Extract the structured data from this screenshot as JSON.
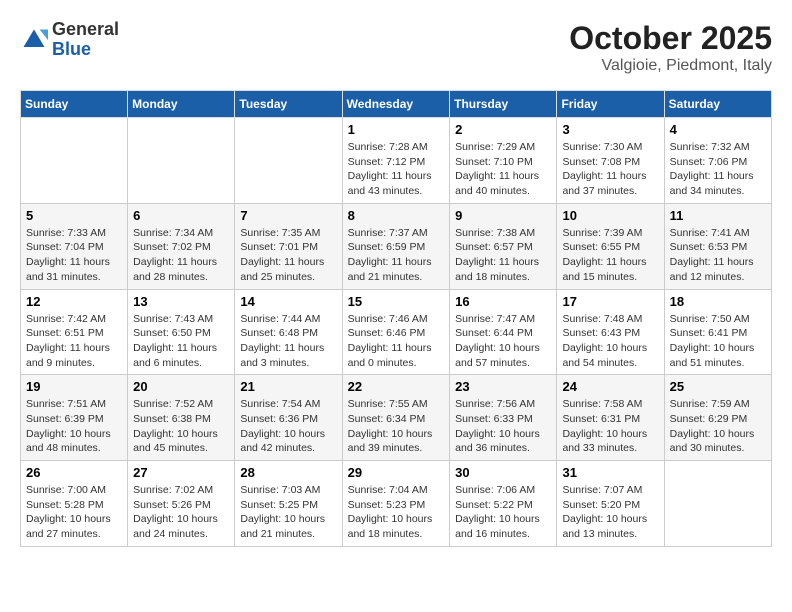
{
  "header": {
    "logo": {
      "general": "General",
      "blue": "Blue"
    },
    "title": "October 2025",
    "location": "Valgioie, Piedmont, Italy"
  },
  "days_of_week": [
    "Sunday",
    "Monday",
    "Tuesday",
    "Wednesday",
    "Thursday",
    "Friday",
    "Saturday"
  ],
  "weeks": [
    [
      {
        "day": "",
        "info": ""
      },
      {
        "day": "",
        "info": ""
      },
      {
        "day": "",
        "info": ""
      },
      {
        "day": "1",
        "info": "Sunrise: 7:28 AM\nSunset: 7:12 PM\nDaylight: 11 hours\nand 43 minutes."
      },
      {
        "day": "2",
        "info": "Sunrise: 7:29 AM\nSunset: 7:10 PM\nDaylight: 11 hours\nand 40 minutes."
      },
      {
        "day": "3",
        "info": "Sunrise: 7:30 AM\nSunset: 7:08 PM\nDaylight: 11 hours\nand 37 minutes."
      },
      {
        "day": "4",
        "info": "Sunrise: 7:32 AM\nSunset: 7:06 PM\nDaylight: 11 hours\nand 34 minutes."
      }
    ],
    [
      {
        "day": "5",
        "info": "Sunrise: 7:33 AM\nSunset: 7:04 PM\nDaylight: 11 hours\nand 31 minutes."
      },
      {
        "day": "6",
        "info": "Sunrise: 7:34 AM\nSunset: 7:02 PM\nDaylight: 11 hours\nand 28 minutes."
      },
      {
        "day": "7",
        "info": "Sunrise: 7:35 AM\nSunset: 7:01 PM\nDaylight: 11 hours\nand 25 minutes."
      },
      {
        "day": "8",
        "info": "Sunrise: 7:37 AM\nSunset: 6:59 PM\nDaylight: 11 hours\nand 21 minutes."
      },
      {
        "day": "9",
        "info": "Sunrise: 7:38 AM\nSunset: 6:57 PM\nDaylight: 11 hours\nand 18 minutes."
      },
      {
        "day": "10",
        "info": "Sunrise: 7:39 AM\nSunset: 6:55 PM\nDaylight: 11 hours\nand 15 minutes."
      },
      {
        "day": "11",
        "info": "Sunrise: 7:41 AM\nSunset: 6:53 PM\nDaylight: 11 hours\nand 12 minutes."
      }
    ],
    [
      {
        "day": "12",
        "info": "Sunrise: 7:42 AM\nSunset: 6:51 PM\nDaylight: 11 hours\nand 9 minutes."
      },
      {
        "day": "13",
        "info": "Sunrise: 7:43 AM\nSunset: 6:50 PM\nDaylight: 11 hours\nand 6 minutes."
      },
      {
        "day": "14",
        "info": "Sunrise: 7:44 AM\nSunset: 6:48 PM\nDaylight: 11 hours\nand 3 minutes."
      },
      {
        "day": "15",
        "info": "Sunrise: 7:46 AM\nSunset: 6:46 PM\nDaylight: 11 hours\nand 0 minutes."
      },
      {
        "day": "16",
        "info": "Sunrise: 7:47 AM\nSunset: 6:44 PM\nDaylight: 10 hours\nand 57 minutes."
      },
      {
        "day": "17",
        "info": "Sunrise: 7:48 AM\nSunset: 6:43 PM\nDaylight: 10 hours\nand 54 minutes."
      },
      {
        "day": "18",
        "info": "Sunrise: 7:50 AM\nSunset: 6:41 PM\nDaylight: 10 hours\nand 51 minutes."
      }
    ],
    [
      {
        "day": "19",
        "info": "Sunrise: 7:51 AM\nSunset: 6:39 PM\nDaylight: 10 hours\nand 48 minutes."
      },
      {
        "day": "20",
        "info": "Sunrise: 7:52 AM\nSunset: 6:38 PM\nDaylight: 10 hours\nand 45 minutes."
      },
      {
        "day": "21",
        "info": "Sunrise: 7:54 AM\nSunset: 6:36 PM\nDaylight: 10 hours\nand 42 minutes."
      },
      {
        "day": "22",
        "info": "Sunrise: 7:55 AM\nSunset: 6:34 PM\nDaylight: 10 hours\nand 39 minutes."
      },
      {
        "day": "23",
        "info": "Sunrise: 7:56 AM\nSunset: 6:33 PM\nDaylight: 10 hours\nand 36 minutes."
      },
      {
        "day": "24",
        "info": "Sunrise: 7:58 AM\nSunset: 6:31 PM\nDaylight: 10 hours\nand 33 minutes."
      },
      {
        "day": "25",
        "info": "Sunrise: 7:59 AM\nSunset: 6:29 PM\nDaylight: 10 hours\nand 30 minutes."
      }
    ],
    [
      {
        "day": "26",
        "info": "Sunrise: 7:00 AM\nSunset: 5:28 PM\nDaylight: 10 hours\nand 27 minutes."
      },
      {
        "day": "27",
        "info": "Sunrise: 7:02 AM\nSunset: 5:26 PM\nDaylight: 10 hours\nand 24 minutes."
      },
      {
        "day": "28",
        "info": "Sunrise: 7:03 AM\nSunset: 5:25 PM\nDaylight: 10 hours\nand 21 minutes."
      },
      {
        "day": "29",
        "info": "Sunrise: 7:04 AM\nSunset: 5:23 PM\nDaylight: 10 hours\nand 18 minutes."
      },
      {
        "day": "30",
        "info": "Sunrise: 7:06 AM\nSunset: 5:22 PM\nDaylight: 10 hours\nand 16 minutes."
      },
      {
        "day": "31",
        "info": "Sunrise: 7:07 AM\nSunset: 5:20 PM\nDaylight: 10 hours\nand 13 minutes."
      },
      {
        "day": "",
        "info": ""
      }
    ]
  ]
}
